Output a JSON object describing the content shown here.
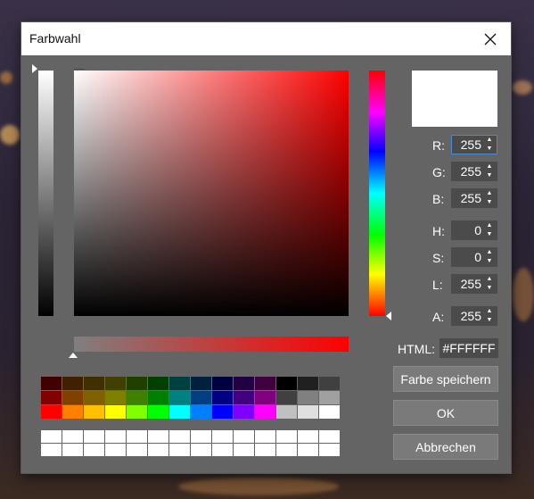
{
  "window": {
    "title": "Farbwahl"
  },
  "icons": {
    "close": "close-icon",
    "marker": "triangle-marker-icon"
  },
  "preview": {
    "color": "#FFFFFF"
  },
  "fields": [
    {
      "key": "r",
      "label": "R:",
      "value": "255"
    },
    {
      "key": "g",
      "label": "G:",
      "value": "255"
    },
    {
      "key": "b",
      "label": "B:",
      "value": "255"
    },
    {
      "key": "h",
      "label": "H:",
      "value": "0"
    },
    {
      "key": "s",
      "label": "S:",
      "value": "0"
    },
    {
      "key": "l",
      "label": "L:",
      "value": "255"
    },
    {
      "key": "a",
      "label": "A:",
      "value": "255"
    }
  ],
  "html": {
    "label": "HTML:",
    "value": "#FFFFFF"
  },
  "buttons": {
    "save": "Farbe speichern",
    "ok": "OK",
    "cancel": "Abbrechen"
  },
  "palette": [
    [
      "#400000",
      "#402000",
      "#403000",
      "#404000",
      "#204000",
      "#004000",
      "#004040",
      "#002040",
      "#000040",
      "#200040",
      "#400040",
      "#000000",
      "#202020",
      "#404040"
    ],
    [
      "#800000",
      "#804000",
      "#806000",
      "#808000",
      "#408000",
      "#008000",
      "#008080",
      "#004080",
      "#000080",
      "#400080",
      "#800080",
      "#404040",
      "#808080",
      "#a0a0a0"
    ],
    [
      "#ff0000",
      "#ff8000",
      "#ffc000",
      "#ffff00",
      "#80ff00",
      "#00ff00",
      "#00ffff",
      "#0080ff",
      "#0000ff",
      "#8000ff",
      "#ff00ff",
      "#c0c0c0",
      "#e0e0e0",
      "#ffffff"
    ]
  ],
  "custom_colors": [
    [
      "#ffffff",
      "#ffffff",
      "#ffffff",
      "#ffffff",
      "#ffffff",
      "#ffffff",
      "#ffffff",
      "#ffffff",
      "#ffffff",
      "#ffffff",
      "#ffffff",
      "#ffffff",
      "#ffffff",
      "#ffffff"
    ],
    [
      "#ffffff",
      "#ffffff",
      "#ffffff",
      "#ffffff",
      "#ffffff",
      "#ffffff",
      "#ffffff",
      "#ffffff",
      "#ffffff",
      "#ffffff",
      "#ffffff",
      "#ffffff",
      "#ffffff",
      "#ffffff"
    ]
  ]
}
